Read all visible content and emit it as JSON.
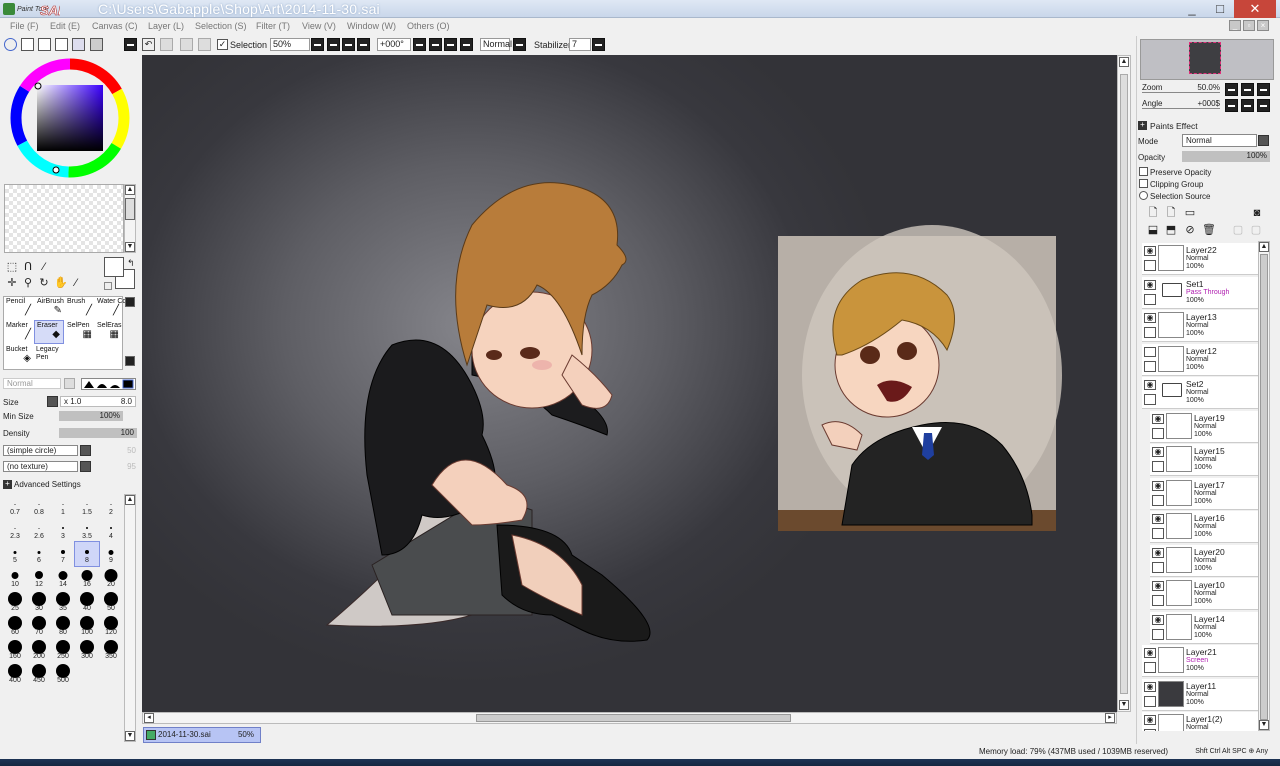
{
  "titlebar": {
    "logo_text": "PaintTool SAI",
    "title": "C:\\Users\\Gabapple\\Shop\\Art\\2014-11-30.sai",
    "minimize": "_",
    "maximize": "□",
    "close": "✕"
  },
  "menu": [
    "File (F)",
    "Edit (E)",
    "Canvas (C)",
    "Layer (L)",
    "Selection (S)",
    "Filter (T)",
    "View (V)",
    "Window (W)",
    "Others (O)"
  ],
  "toolbar": {
    "selection_label": "Selection",
    "zoom": "50%",
    "angle": "+000°",
    "mode": "Normal",
    "stabilizer_label": "Stabilizer",
    "stabilizer_value": "7"
  },
  "tools": {
    "brushes": [
      {
        "name": "Pencil",
        "icon": "pencil-icon"
      },
      {
        "name": "AirBrush",
        "icon": "airbrush-icon"
      },
      {
        "name": "Brush",
        "icon": "brush-icon"
      },
      {
        "name": "Water Color",
        "icon": "watercolor-icon"
      },
      {
        "name": "Marker",
        "icon": "marker-icon"
      },
      {
        "name": "Eraser",
        "icon": "eraser-icon",
        "selected": true
      },
      {
        "name": "SelPen",
        "icon": "selpen-icon"
      },
      {
        "name": "SelEras",
        "icon": "seleras-icon"
      },
      {
        "name": "Bucket",
        "icon": "bucket-icon"
      },
      {
        "name": "Legacy Pen",
        "icon": "legacy-pen-icon"
      }
    ]
  },
  "brush_settings": {
    "mode": "Normal",
    "size_label": "Size",
    "size_multiplier": "x 1.0",
    "size_value": "8.0",
    "min_size_label": "Min Size",
    "min_size_value": "100%",
    "density_label": "Density",
    "density_value": "100",
    "shape": "(simple circle)",
    "shape_value": "50",
    "texture": "(no texture)",
    "texture_value": "95",
    "advanced": "Advanced Settings"
  },
  "brush_sizes": [
    {
      "v": "0.7",
      "s": 1
    },
    {
      "v": "0.8",
      "s": 1
    },
    {
      "v": "1",
      "s": 1
    },
    {
      "v": "1.5",
      "s": 1
    },
    {
      "v": "2",
      "s": 1
    },
    {
      "v": "2.3",
      "s": 1
    },
    {
      "v": "2.6",
      "s": 1
    },
    {
      "v": "3",
      "s": 2
    },
    {
      "v": "3.5",
      "s": 2
    },
    {
      "v": "4",
      "s": 2
    },
    {
      "v": "5",
      "s": 3
    },
    {
      "v": "6",
      "s": 3
    },
    {
      "v": "7",
      "s": 4
    },
    {
      "v": "8",
      "s": 4,
      "selected": true
    },
    {
      "v": "9",
      "s": 5
    },
    {
      "v": "10",
      "s": 7
    },
    {
      "v": "12",
      "s": 8
    },
    {
      "v": "14",
      "s": 9
    },
    {
      "v": "16",
      "s": 11
    },
    {
      "v": "20",
      "s": 13
    },
    {
      "v": "25",
      "s": 14
    },
    {
      "v": "30",
      "s": 14
    },
    {
      "v": "35",
      "s": 14
    },
    {
      "v": "40",
      "s": 14
    },
    {
      "v": "50",
      "s": 14
    },
    {
      "v": "60",
      "s": 14
    },
    {
      "v": "70",
      "s": 14
    },
    {
      "v": "80",
      "s": 14
    },
    {
      "v": "100",
      "s": 14
    },
    {
      "v": "120",
      "s": 14
    },
    {
      "v": "160",
      "s": 14
    },
    {
      "v": "200",
      "s": 14
    },
    {
      "v": "250",
      "s": 14
    },
    {
      "v": "300",
      "s": 14
    },
    {
      "v": "350",
      "s": 14
    },
    {
      "v": "400",
      "s": 14
    },
    {
      "v": "450",
      "s": 14
    },
    {
      "v": "500",
      "s": 14
    }
  ],
  "navigator": {
    "zoom_label": "Zoom",
    "zoom_value": "50.0%",
    "angle_label": "Angle",
    "angle_value": "+000$"
  },
  "layer_props": {
    "paints_effect": "Paints Effect",
    "mode_label": "Mode",
    "mode_value": "Normal",
    "opacity_label": "Opacity",
    "opacity_value": "100%",
    "preserve_opacity": "Preserve Opacity",
    "clipping_group": "Clipping Group",
    "selection_source": "Selection Source"
  },
  "layers": [
    {
      "name": "Layer22",
      "mode": "Normal",
      "opacity": "100%",
      "visible": true
    },
    {
      "name": "Set1",
      "mode": "Pass Through",
      "opacity": "100%",
      "visible": true,
      "folder": true
    },
    {
      "name": "Layer13",
      "mode": "Normal",
      "opacity": "100%",
      "visible": true
    },
    {
      "name": "Layer12",
      "mode": "Normal",
      "opacity": "100%",
      "visible": false
    },
    {
      "name": "Set2",
      "mode": "Normal",
      "opacity": "100%",
      "visible": true,
      "folder": true
    },
    {
      "name": "Layer19",
      "mode": "Normal",
      "opacity": "100%",
      "visible": true,
      "indent": true
    },
    {
      "name": "Layer15",
      "mode": "Normal",
      "opacity": "100%",
      "visible": true,
      "indent": true
    },
    {
      "name": "Layer17",
      "mode": "Normal",
      "opacity": "100%",
      "visible": true,
      "indent": true
    },
    {
      "name": "Layer16",
      "mode": "Normal",
      "opacity": "100%",
      "visible": true,
      "indent": true
    },
    {
      "name": "Layer20",
      "mode": "Normal",
      "opacity": "100%",
      "visible": true,
      "indent": true
    },
    {
      "name": "Layer10",
      "mode": "Normal",
      "opacity": "100%",
      "visible": true,
      "indent": true
    },
    {
      "name": "Layer14",
      "mode": "Normal",
      "opacity": "100%",
      "visible": true,
      "indent": true
    },
    {
      "name": "Layer21",
      "mode": "Screen",
      "opacity": "100%",
      "visible": true
    },
    {
      "name": "Layer11",
      "mode": "Normal",
      "opacity": "100%",
      "visible": true
    },
    {
      "name": "Layer1(2)",
      "mode": "Normal",
      "opacity": "",
      "visible": true
    }
  ],
  "document_tab": {
    "name": "2014-11-30.sai",
    "zoom": "50%"
  },
  "status": {
    "memory": "Memory load: 79% (437MB used / 1039MB reserved)",
    "keys": "Shft Ctrl Alt SPC ⊕ Any"
  }
}
